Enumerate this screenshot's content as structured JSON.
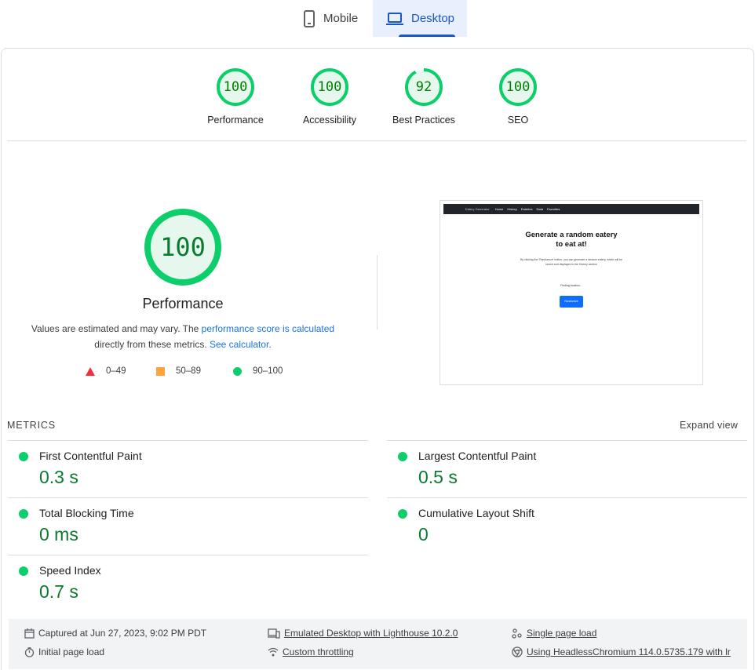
{
  "tabs": [
    {
      "label": "Mobile",
      "icon": "smartphone-icon",
      "active": false
    },
    {
      "label": "Desktop",
      "icon": "laptop-icon",
      "active": true
    }
  ],
  "colors": {
    "pass": "#0cce6b",
    "pass_text": "#0a7a2e",
    "average": "#ffa33a",
    "fail": "#f0303c",
    "link": "#1a73e8",
    "active_tab": "#1a56c4"
  },
  "summary": [
    {
      "score": "100",
      "value": 100,
      "label": "Performance"
    },
    {
      "score": "100",
      "value": 100,
      "label": "Accessibility"
    },
    {
      "score": "92",
      "value": 92,
      "label": "Best Practices"
    },
    {
      "score": "100",
      "value": 100,
      "label": "SEO"
    }
  ],
  "performance": {
    "score": "100",
    "value": 100,
    "title": "Performance",
    "desc_prefix": "Values are estimated and may vary. The ",
    "desc_link1": "performance score is calculated",
    "desc_mid": "directly from these metrics. ",
    "desc_link2": "See calculator",
    "desc_suffix": "."
  },
  "legend": [
    {
      "shape": "triangle",
      "range": "0–49"
    },
    {
      "shape": "square",
      "range": "50–89"
    },
    {
      "shape": "circle",
      "range": "90–100"
    }
  ],
  "screenshot": {
    "brand": "Eatery Generator",
    "nav_links": [
      "Home",
      "History",
      "Eateries",
      "Data",
      "Favorites"
    ],
    "heading_line1": "Generate a random eatery",
    "heading_line2": "to eat at!",
    "subtext": "By clicking the 'Randomize' button, you can generate a random eatery, which will be stored and displayed in the History section",
    "status": "Finding location...",
    "button": "Randomize"
  },
  "metrics": {
    "label": "METRICS",
    "expand_label": "Expand view",
    "items": [
      {
        "name": "First Contentful Paint",
        "value": "0.3 s"
      },
      {
        "name": "Largest Contentful Paint",
        "value": "0.5 s"
      },
      {
        "name": "Total Blocking Time",
        "value": "0 ms"
      },
      {
        "name": "Cumulative Layout Shift",
        "value": "0"
      },
      {
        "name": "Speed Index",
        "value": "0.7 s"
      }
    ]
  },
  "info": {
    "captured": "Captured at Jun 27, 2023, 9:02 PM PDT",
    "initial": "Initial page load",
    "emulated": "Emulated Desktop with Lighthouse 10.2.0",
    "throttling": "Custom throttling",
    "single": "Single page load",
    "using": "Using HeadlessChromium 114.0.5735.179 with lr"
  }
}
